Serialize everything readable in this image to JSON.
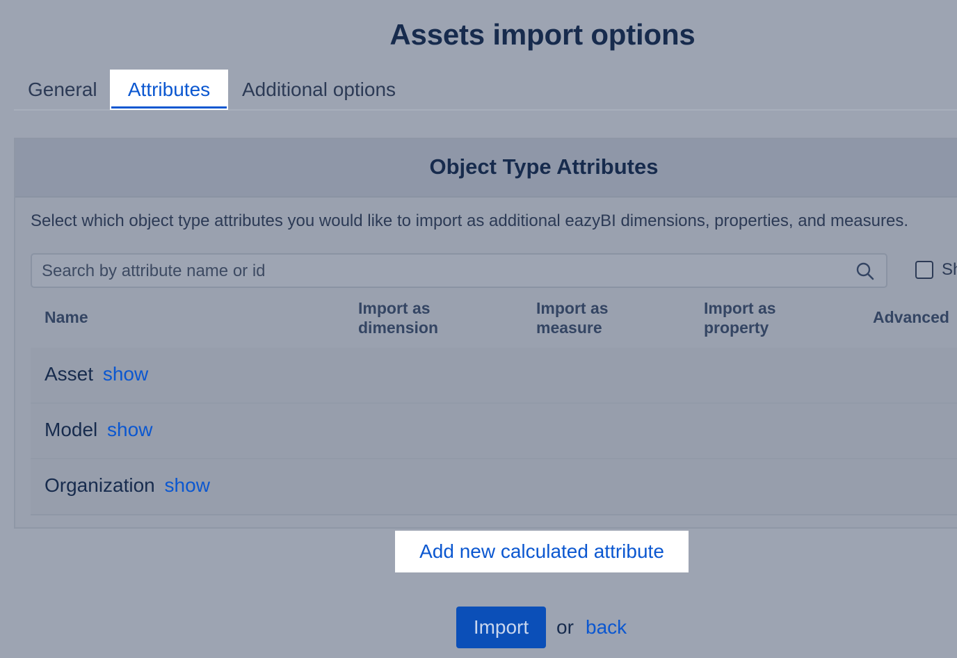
{
  "page": {
    "title": "Assets import options"
  },
  "tabs": [
    {
      "label": "General",
      "active": false
    },
    {
      "label": "Attributes",
      "active": true
    },
    {
      "label": "Additional options",
      "active": false
    }
  ],
  "panel": {
    "title": "Object Type Attributes",
    "description": "Select which object type attributes you would like to import as additional eazyBI dimensions, properties, and measures.",
    "search": {
      "placeholder": "Search by attribute name or id",
      "value": ""
    },
    "show_checkbox": {
      "label": "Sh",
      "checked": false
    },
    "columns": [
      "Name",
      "Import as dimension",
      "Import as measure",
      "Import as property",
      "Advanced"
    ],
    "rows": [
      {
        "name": "Asset",
        "link": "show"
      },
      {
        "name": "Model",
        "link": "show"
      },
      {
        "name": "Organization",
        "link": "show"
      }
    ]
  },
  "actions": {
    "add_calculated": "Add new calculated attribute",
    "import_label": "Import",
    "or_text": "or",
    "back_label": "back"
  },
  "colors": {
    "accent": "#0b57d0",
    "button": "#0b4fb8",
    "text": "#172b4d"
  }
}
